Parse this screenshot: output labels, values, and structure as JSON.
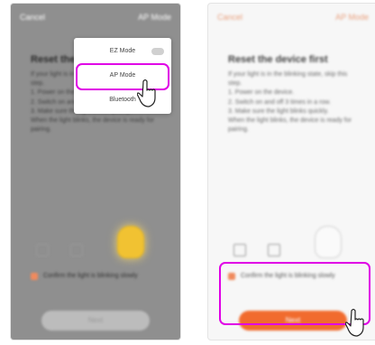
{
  "screens": [
    {
      "topbar": {
        "cancel": "Cancel",
        "mode": "AP Mode"
      },
      "title": "Reset the device first",
      "instructions": [
        "If your light is in the blinking state, skip this step.",
        "1. Power on the device.",
        "2. Switch on and off 3 times in a row.",
        "3. Make sure the light blinks quickly.",
        "When the light blinks, the device is ready for pairing."
      ],
      "confirm_text": "Confirm the light is blinking slowly",
      "next_label": "Next",
      "menu": {
        "items": [
          "EZ Mode",
          "AP Mode",
          "Bluetooth"
        ]
      }
    },
    {
      "topbar": {
        "cancel": "Cancel",
        "mode": "AP Mode"
      },
      "title": "Reset the device first",
      "instructions": [
        "If your light is in the blinking state, skip this step.",
        "1. Power on the device.",
        "2. Switch on and off 3 times in a row.",
        "3. Make sure the light blinks quickly.",
        "When the light blinks, the device is ready for pairing."
      ],
      "confirm_text": "Confirm the light is blinking slowly",
      "next_label": "Next"
    }
  ],
  "icons": {
    "pointer": "hand-pointer-icon"
  },
  "colors": {
    "accent": "#f16b2e",
    "highlight": "#e000e6"
  }
}
